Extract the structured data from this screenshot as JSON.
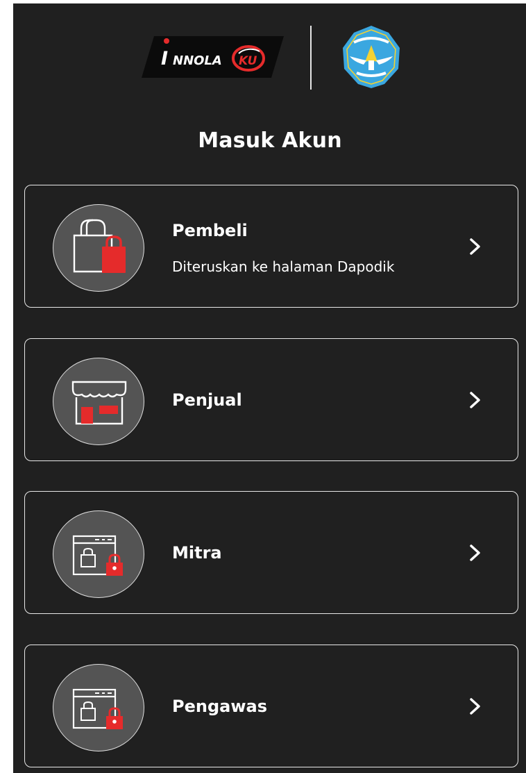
{
  "header": {
    "logo_text": "INNOLA KU",
    "emblem_label": "Tut Wuri Handayani"
  },
  "page_title": "Masuk Akun",
  "cards": [
    {
      "title": "Pembeli",
      "subtitle": "Diteruskan ke halaman Dapodik",
      "icon": "shopping-bag-lock-icon"
    },
    {
      "title": "Penjual",
      "icon": "storefront-icon"
    },
    {
      "title": "Mitra",
      "icon": "browser-bag-lock-icon"
    },
    {
      "title": "Pengawas",
      "icon": "browser-bag-lock-icon"
    }
  ],
  "colors": {
    "background": "#202020",
    "card_border": "#e9e9e9",
    "icon_circle": "#545454",
    "accent_red": "#e52b2b",
    "emblem_blue": "#3aa7e0"
  }
}
